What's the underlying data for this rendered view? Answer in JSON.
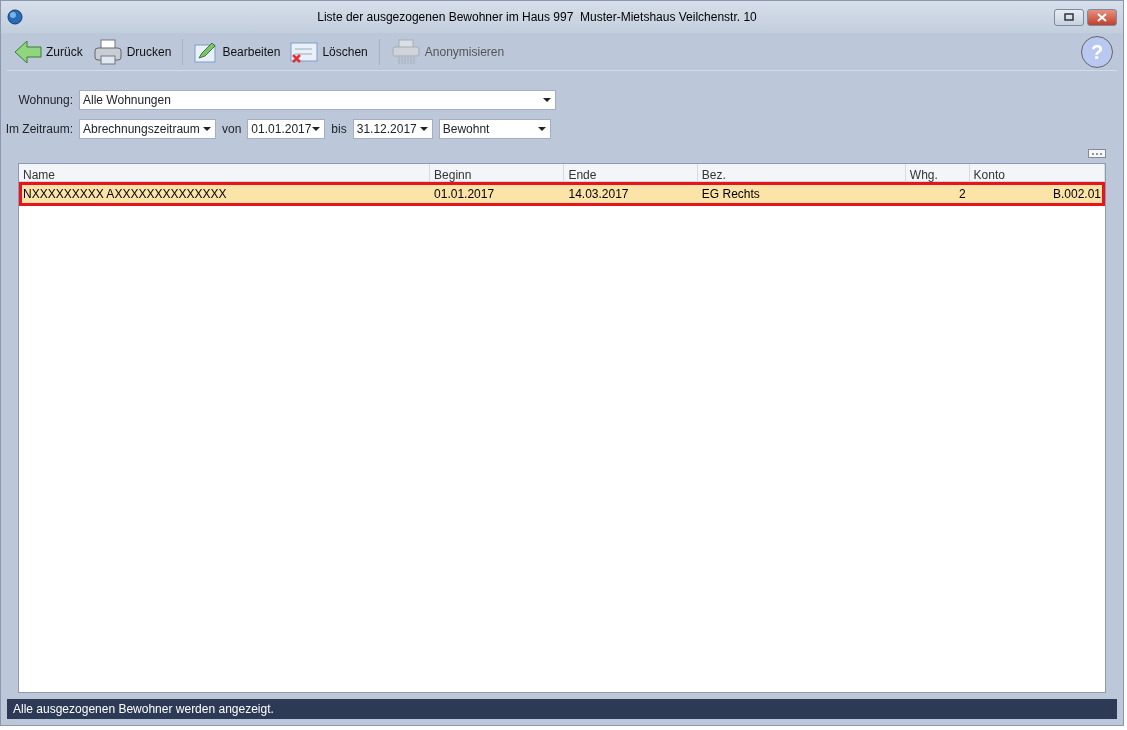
{
  "window": {
    "title": "Liste der ausgezogenen Bewohner im Haus 997  Muster-Mietshaus Veilchenstr. 10"
  },
  "toolbar": [
    {
      "label": "Zurück",
      "kind": "back",
      "disabled": false
    },
    {
      "label": "Drucken",
      "kind": "print",
      "disabled": false
    },
    {
      "label": "Bearbeiten",
      "kind": "edit",
      "disabled": false
    },
    {
      "label": "Löschen",
      "kind": "delete",
      "disabled": false
    },
    {
      "label": "Anonymisieren",
      "kind": "shred",
      "disabled": true
    }
  ],
  "help": "?",
  "filters": {
    "wohnung_label": "Wohnung:",
    "wohnung": "Alle Wohnungen",
    "zeitraum_label": "Im Zeitraum:",
    "zeitraum": "Abrechnungszeitraum",
    "von_label": "von",
    "von": "01.01.2017",
    "bis_label": "bis",
    "bis": "31.12.2017",
    "status": "Bewohnt"
  },
  "table": {
    "columns": [
      "Name",
      "Beginn",
      "Ende",
      "Bez.",
      "Whg.",
      "Konto"
    ],
    "rows": [
      {
        "cells": [
          "NXXXXXXXXX AXXXXXXXXXXXXXX",
          "01.01.2017",
          "14.03.2017",
          "EG Rechts",
          "2",
          "B.002.01"
        ],
        "selected": true
      }
    ]
  },
  "status_bar": "Alle ausgezogenen Bewohner werden angezeigt."
}
